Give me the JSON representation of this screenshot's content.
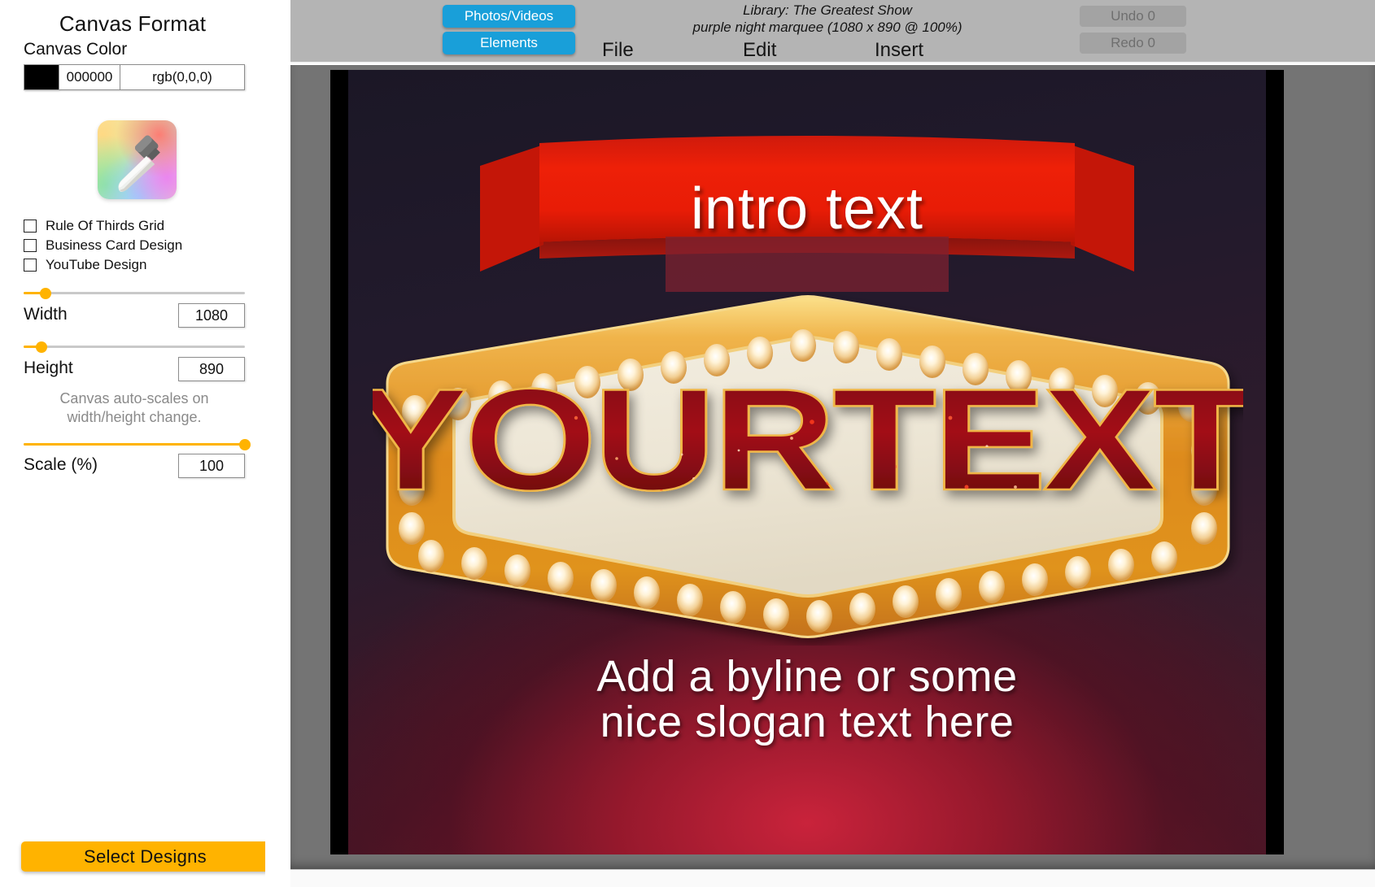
{
  "sidebar": {
    "title": "Canvas Format",
    "canvas_color_label": "Canvas Color",
    "color": {
      "swatch_hex": "#000000",
      "hex_value": "000000",
      "rgb_value": "rgb(0,0,0)",
      "eyedropper_icon": "eyedropper-icon"
    },
    "checkboxes": [
      {
        "label": "Rule Of Thirds Grid",
        "checked": false
      },
      {
        "label": "Business Card Design",
        "checked": false
      },
      {
        "label": "YouTube Design",
        "checked": false
      }
    ],
    "width": {
      "label": "Width",
      "value": "1080",
      "slider_percent": 10
    },
    "height": {
      "label": "Height",
      "value": "890",
      "slider_percent": 8
    },
    "autoscale_note": "Canvas auto-scales on width/height change.",
    "scale": {
      "label": "Scale (%)",
      "value": "100",
      "slider_percent": 100
    },
    "select_designs_label": "Select Designs",
    "accent_color": "#ffb300"
  },
  "toolbar": {
    "photos_videos_label": "Photos/Videos",
    "elements_label": "Elements",
    "button_color": "#199fd9",
    "library_info": "Library: The Greatest Show\npurple night marquee (1080 x 890 @ 100%)",
    "library_line1": "Library: The Greatest Show",
    "library_line2": "purple night marquee (1080 x 890 @ 100%)",
    "menus": [
      {
        "label": "File"
      },
      {
        "label": "Edit"
      },
      {
        "label": "Insert"
      }
    ],
    "undo_label": "Undo 0",
    "redo_label": "Redo 0"
  },
  "canvas": {
    "document_width": "1080",
    "document_height": "890",
    "zoom": "100%",
    "background_color": "#000000",
    "design": {
      "name": "purple night marquee",
      "intro_text": "intro text",
      "headline_text": "YOURTEXT",
      "byline_line1": "Add a byline or some",
      "byline_line2": "nice slogan text here",
      "ribbon_color": "#e01b0c",
      "marquee_frame_color": "#e08a1e",
      "marquee_panel_color": "#ece4d3",
      "headline_fill": "#8c0d14"
    }
  }
}
